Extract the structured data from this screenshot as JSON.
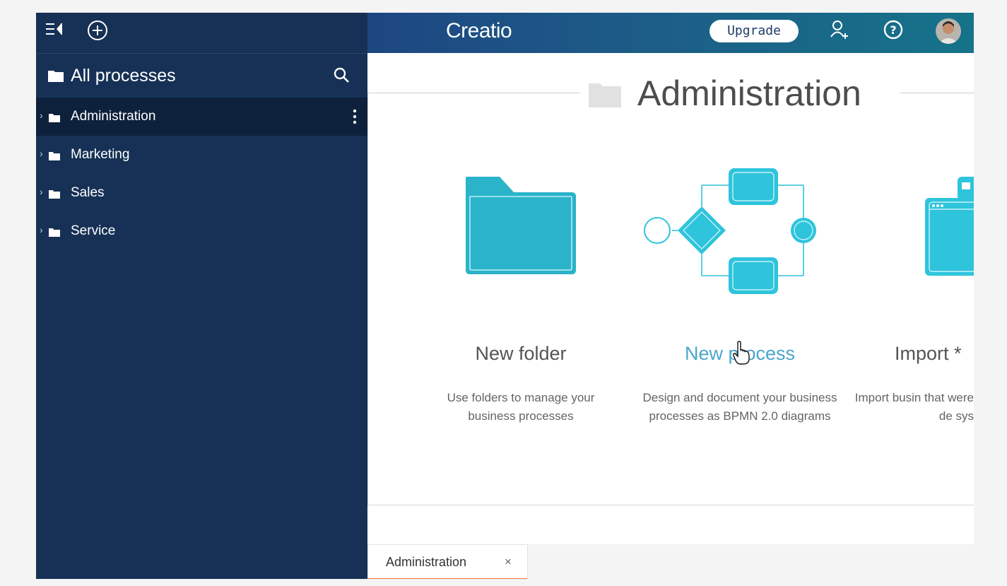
{
  "header": {
    "logo": "Creatio",
    "upgrade_label": "Upgrade",
    "icons": [
      "sidebar-collapse-icon",
      "add-icon",
      "add-user-icon",
      "help-icon",
      "avatar"
    ]
  },
  "sidebar": {
    "title": "All processes",
    "items": [
      {
        "label": "Administration",
        "active": true
      },
      {
        "label": "Marketing",
        "active": false
      },
      {
        "label": "Sales",
        "active": false
      },
      {
        "label": "Service",
        "active": false
      }
    ]
  },
  "main": {
    "section_title": "Administration",
    "cards": [
      {
        "title": "New folder",
        "desc": "Use folders to manage your business processes",
        "icon": "folder-icon"
      },
      {
        "title": "New process",
        "desc": "Design and document your business processes as BPMN 2.0 diagrams",
        "icon": "bpmn-diagram-icon"
      },
      {
        "title": "Import *",
        "desc": "Import busin that were de sys",
        "icon": "import-window-icon"
      }
    ]
  },
  "tabs": [
    {
      "label": "Administration",
      "close": "×"
    }
  ],
  "colors": {
    "sidebar_bg": "#163155",
    "accent": "#2ec4dc",
    "link": "#4ba6cc"
  }
}
